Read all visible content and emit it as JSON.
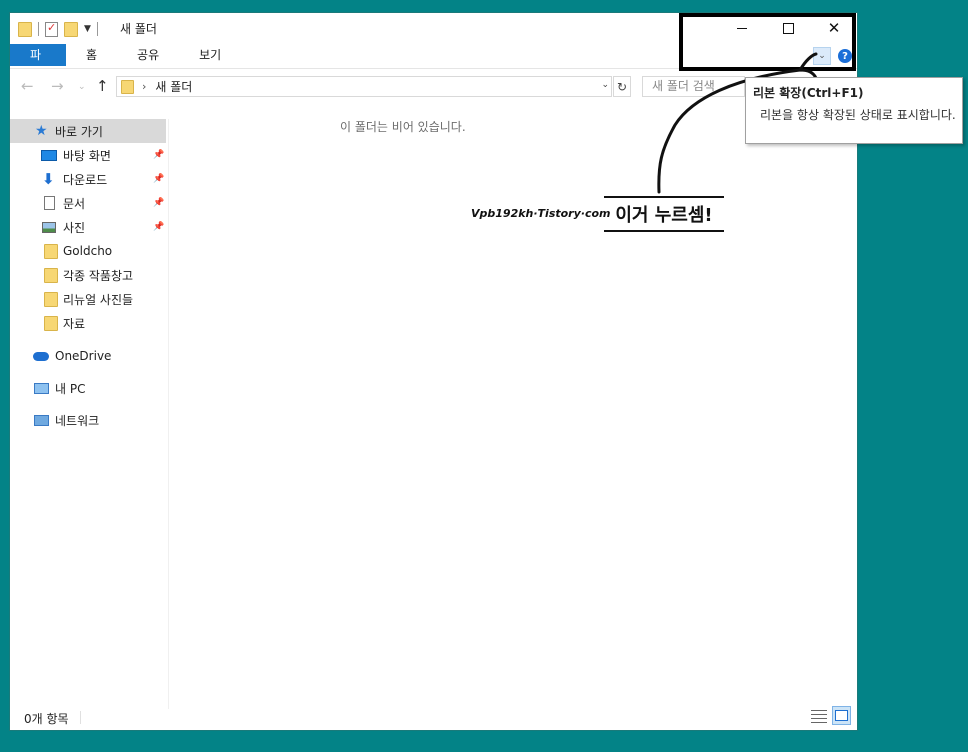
{
  "window": {
    "title": "새 폴더",
    "controls": {
      "minimize": "minimize-icon",
      "maximize": "maximize-icon",
      "close": "✕"
    }
  },
  "ribbon": {
    "tabs": [
      {
        "label": "파일"
      },
      {
        "label": "홈"
      },
      {
        "label": "공유"
      },
      {
        "label": "보기"
      }
    ],
    "toggle_icon": "chevron-down-icon",
    "help_label": "?"
  },
  "navigation": {
    "back": "←",
    "forward": "→",
    "recent": "⌄",
    "up": "↑",
    "address_chevron": "›",
    "address_path": "새 폴더",
    "address_dropdown": "⌄",
    "refresh": "↻",
    "search_placeholder": "새 폴더 검색"
  },
  "sidebar": {
    "items": [
      {
        "label": "바로 가기",
        "icon": "star-icon"
      },
      {
        "label": "바탕 화면",
        "icon": "desktop-icon",
        "pinned": true
      },
      {
        "label": "다운로드",
        "icon": "download-icon",
        "pinned": true
      },
      {
        "label": "문서",
        "icon": "document-icon",
        "pinned": true
      },
      {
        "label": "사진",
        "icon": "picture-icon",
        "pinned": true
      },
      {
        "label": "Goldcho",
        "icon": "folder-icon"
      },
      {
        "label": "각종 작품창고",
        "icon": "folder-icon"
      },
      {
        "label": "리뉴얼 사진들",
        "icon": "folder-icon"
      },
      {
        "label": "자료",
        "icon": "folder-icon"
      },
      {
        "label": "OneDrive",
        "icon": "cloud-icon"
      },
      {
        "label": "내 PC",
        "icon": "pc-icon"
      },
      {
        "label": "네트워크",
        "icon": "network-icon"
      }
    ],
    "pin_glyph": "📌"
  },
  "content": {
    "empty_message": "이 폴더는 비어 있습니다.",
    "watermark": "Vpb192kh·Tistory·com",
    "callout": "이거 누르셈!"
  },
  "status": {
    "item_count": "0개 항목"
  },
  "tooltip": {
    "title": "리본 확장(Ctrl+F1)",
    "body": "리본을 항상 확장된 상태로 표시합니다."
  },
  "colors": {
    "desktop_bg": "#038387",
    "file_tab": "#1979ca",
    "selected_nav": "#d9d9d9"
  }
}
